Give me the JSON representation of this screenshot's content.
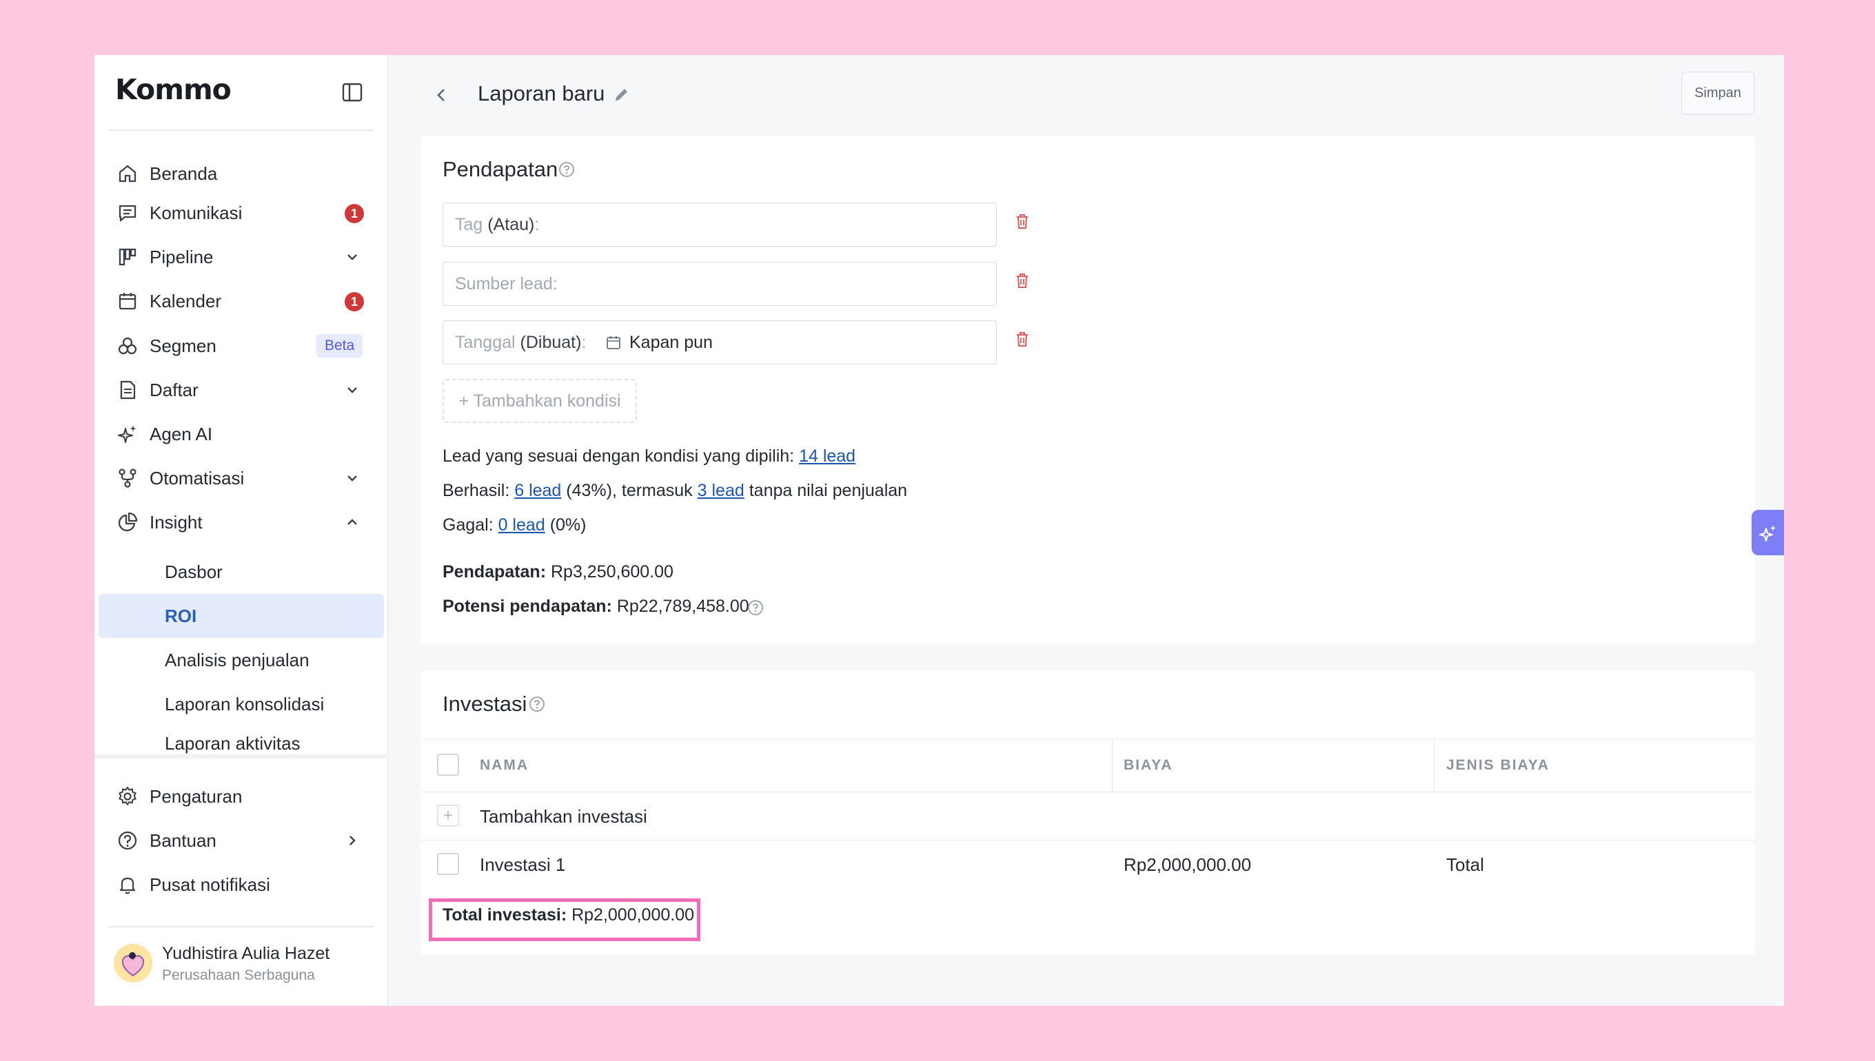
{
  "app": {
    "logo": "Kommo"
  },
  "sidebar": {
    "nav": [
      {
        "label": "Beranda",
        "icon": "home-icon"
      },
      {
        "label": "Komunikasi",
        "icon": "chat-icon",
        "badge": "1"
      },
      {
        "label": "Pipeline",
        "icon": "pipeline-icon",
        "chevron": "down"
      },
      {
        "label": "Kalender",
        "icon": "calendar-icon",
        "badge": "1"
      },
      {
        "label": "Segmen",
        "icon": "segment-icon",
        "tag": "Beta"
      },
      {
        "label": "Daftar",
        "icon": "document-icon",
        "chevron": "down"
      },
      {
        "label": "Agen AI",
        "icon": "sparkle-icon"
      },
      {
        "label": "Otomatisasi",
        "icon": "automation-icon",
        "chevron": "down"
      },
      {
        "label": "Insight",
        "icon": "chart-pie-icon",
        "chevron": "up"
      }
    ],
    "insight_sub": [
      "Dasbor",
      "ROI",
      "Analisis penjualan",
      "Laporan konsolidasi",
      "Laporan aktivitas"
    ],
    "active_sub": "ROI",
    "bottom": [
      {
        "label": "Pengaturan",
        "icon": "gear-icon"
      },
      {
        "label": "Bantuan",
        "icon": "help-icon",
        "chevron": "right"
      },
      {
        "label": "Pusat notifikasi",
        "icon": "bell-icon"
      }
    ],
    "user": {
      "name": "Yudhistira Aulia Hazet",
      "company": "Perusahaan Serbaguna"
    }
  },
  "header": {
    "title": "Laporan baru",
    "save_label": "Simpan"
  },
  "revenue": {
    "title": "Pendapatan",
    "filters": [
      {
        "label": "Tag",
        "qualifier": "(Atau)",
        "suffix": ":"
      },
      {
        "label": "Sumber lead:"
      },
      {
        "label": "Tanggal",
        "qualifier": "(Dibuat)",
        "suffix": ":",
        "value": "Kapan pun"
      }
    ],
    "add_condition": "+ Tambahkan kondisi",
    "match_text": "Lead yang sesuai dengan kondisi yang dipilih:",
    "match_link": "14 lead",
    "success_label": "Berhasil:",
    "success_link": "6 lead",
    "success_pct": "(43%), termasuk",
    "success_link2": "3 lead",
    "success_tail": "tanpa nilai penjualan",
    "fail_label": "Gagal:",
    "fail_link": "0 lead",
    "fail_pct": "(0%)",
    "revenue_label": "Pendapatan:",
    "revenue_value": "Rp3,250,600.00",
    "potential_label": "Potensi pendapatan:",
    "potential_value": "Rp22,789,458.00"
  },
  "investment": {
    "title": "Investasi",
    "columns": [
      "NAMA",
      "BIAYA",
      "JENIS BIAYA"
    ],
    "add_label": "Tambahkan investasi",
    "rows": [
      {
        "name": "Investasi 1",
        "cost": "Rp2,000,000.00",
        "type": "Total"
      }
    ],
    "total_label": "Total investasi:",
    "total_value": "Rp2,000,000.00"
  },
  "colors": {
    "accent": "#2861b7",
    "badge": "#cf3837",
    "highlight": "#f26bb5",
    "background": "#fec9e0"
  }
}
